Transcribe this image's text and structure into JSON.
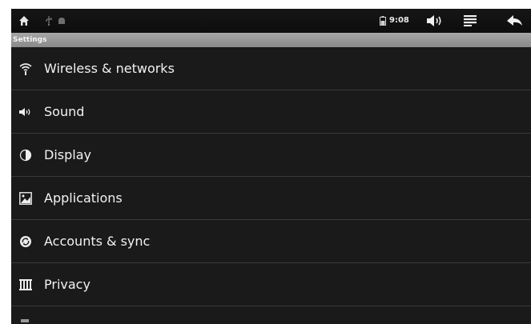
{
  "status_bar": {
    "time": "9:08",
    "icons": [
      "home-icon",
      "usb-icon",
      "android-debug-icon",
      "battery-icon",
      "volume-icon",
      "menu-icon",
      "back-icon"
    ]
  },
  "title_bar": {
    "title": "Settings"
  },
  "settings": {
    "items": [
      {
        "label": "Wireless & networks",
        "icon": "wifi-icon"
      },
      {
        "label": "Sound",
        "icon": "speaker-icon"
      },
      {
        "label": "Display",
        "icon": "display-icon"
      },
      {
        "label": "Applications",
        "icon": "applications-icon"
      },
      {
        "label": "Accounts & sync",
        "icon": "sync-icon"
      },
      {
        "label": "Privacy",
        "icon": "privacy-icon"
      }
    ]
  },
  "colors": {
    "background": "#1a1a1a",
    "title_bar": "#9a9a9a",
    "text": "#f2f2f2",
    "divider": "#3a3a3a"
  }
}
